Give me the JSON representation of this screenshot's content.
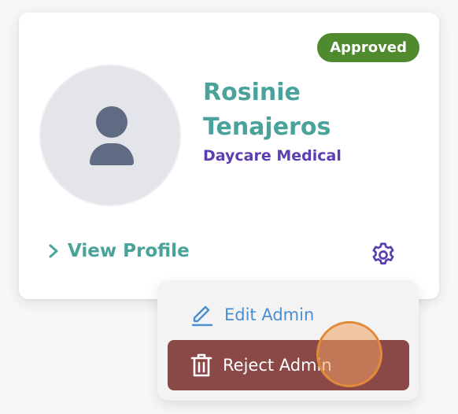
{
  "card": {
    "status_badge": "Approved",
    "name_first": "Rosinie",
    "name_last": "Tenajeros",
    "organization": "Daycare Medical",
    "view_profile_label": "View Profile"
  },
  "menu": {
    "edit_label": "Edit Admin",
    "reject_label": "Reject Admin"
  },
  "icons": {
    "avatar": "person-placeholder-icon",
    "view_profile": "chevron-right-icon",
    "settings": "gear-icon",
    "edit": "pencil-icon",
    "reject": "trash-icon"
  },
  "colors": {
    "badge_bg": "#4f8a2f",
    "name_text": "#4aa39a",
    "organization_text": "#5b3fb1",
    "edit_text": "#4b8fcf",
    "reject_bg": "#8a4846",
    "avatar_bg": "#e4e5ea",
    "avatar_figure": "#5f6b82"
  }
}
